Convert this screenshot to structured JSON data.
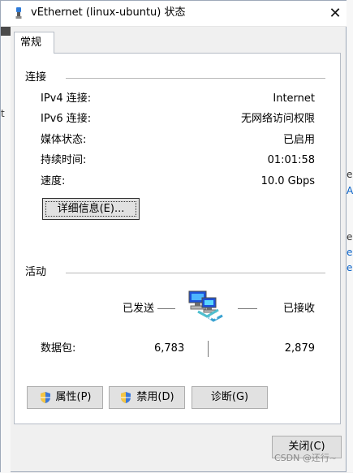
{
  "window": {
    "title": "vEthernet (linux-ubuntu) 状态",
    "close_symbol": "✕"
  },
  "tabs": [
    {
      "label": "常规"
    }
  ],
  "connection": {
    "title": "连接",
    "rows": [
      {
        "label": "IPv4 连接:",
        "value": "Internet"
      },
      {
        "label": "IPv6 连接:",
        "value": "无网络访问权限"
      },
      {
        "label": "媒体状态:",
        "value": "已启用"
      },
      {
        "label": "持续时间:",
        "value": "01:01:58"
      },
      {
        "label": "速度:",
        "value": "10.0 Gbps"
      }
    ],
    "details_button_label": "详细信息(E)..."
  },
  "activity": {
    "title": "活动",
    "sent_label": "已发送",
    "received_label": "已接收",
    "packets_label": "数据包:",
    "packets_sent": "6,783",
    "packets_received": "2,879"
  },
  "buttons": {
    "properties": "属性(P)",
    "disable": "禁用(D)",
    "diagnose": "诊断(G)",
    "close": "关闭(C)"
  },
  "background_text": {
    "left_char": "t",
    "right_chars": [
      "e",
      "A",
      "e",
      "e",
      "e"
    ],
    "watermark": "CSDN @还行~"
  },
  "colors": {
    "panel_border": "#b6bcc6",
    "window_background": "#f0f0f0",
    "button_background": "#e1e1e1",
    "background_accent_blue": "#0a63c9"
  },
  "icons": {
    "title_icon": "network-adapter-icon",
    "close_icon": "close-icon",
    "activity_icon": "network-computers-icon",
    "shield_icon": "shield-icon"
  }
}
